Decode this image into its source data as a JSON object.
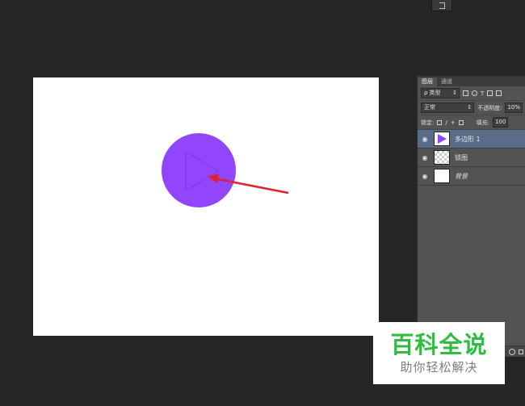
{
  "panel": {
    "tabs": [
      "图层",
      "通道"
    ],
    "filter_select": "ρ 类型",
    "blend_mode": "正常",
    "opacity_label": "不透明度:",
    "opacity_value": "10%",
    "lock_label": "锁定:",
    "fill_label": "填充:",
    "fill_value": "100"
  },
  "layers": [
    {
      "name": "多边形 1",
      "selected": true
    },
    {
      "name": "锁图",
      "selected": false
    },
    {
      "name": "背景",
      "selected": false
    }
  ],
  "watermark": {
    "title": "百科全说",
    "subtitle": "助你轻松解决",
    "title_color": "#2dbd3f"
  },
  "colors": {
    "circle": "#9146fb",
    "arrow": "#e0222c"
  }
}
